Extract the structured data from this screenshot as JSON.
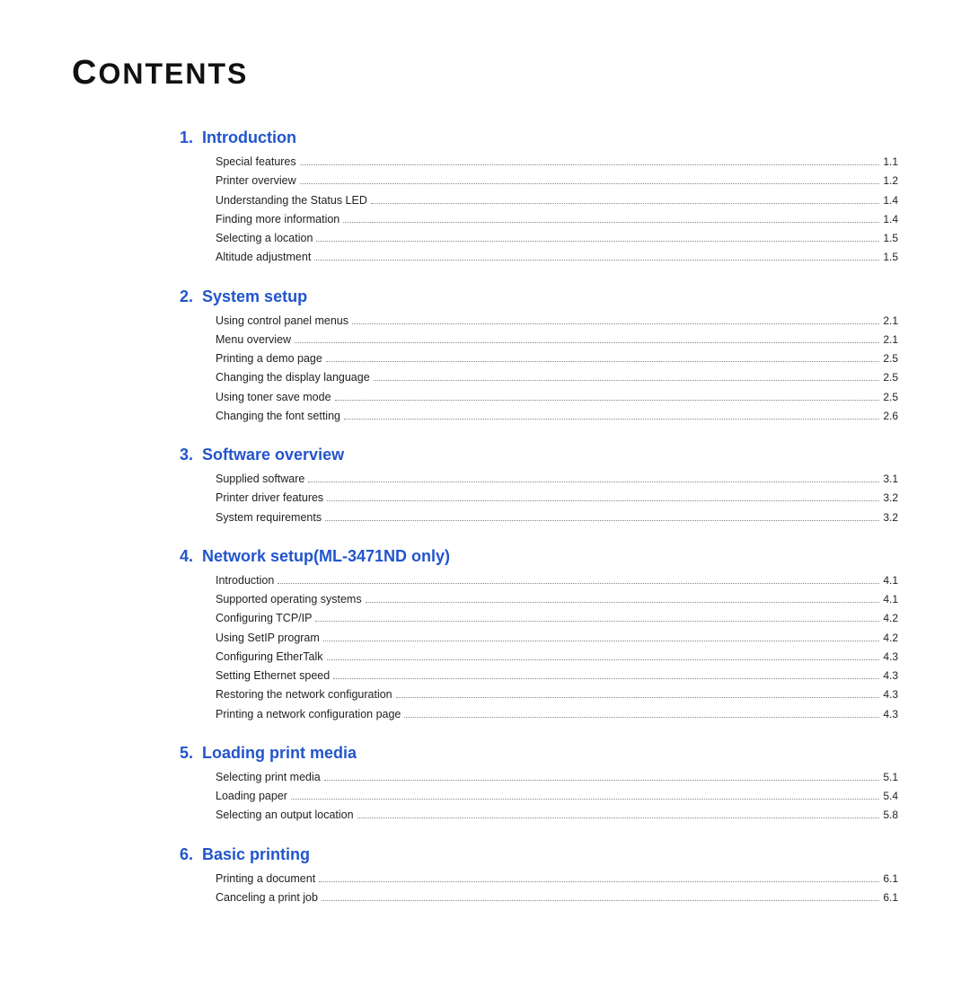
{
  "title": "Contents",
  "sections": [
    {
      "number": "1.",
      "heading": "Introduction",
      "entries": [
        {
          "label": "Special features",
          "page": "1.1"
        },
        {
          "label": "Printer overview",
          "page": "1.2"
        },
        {
          "label": "Understanding the Status LED",
          "page": "1.4"
        },
        {
          "label": "Finding more information",
          "page": "1.4"
        },
        {
          "label": "Selecting a location",
          "page": "1.5"
        },
        {
          "label": "Altitude adjustment",
          "page": "1.5"
        }
      ]
    },
    {
      "number": "2.",
      "heading": "System setup",
      "entries": [
        {
          "label": "Using control panel menus",
          "page": "2.1"
        },
        {
          "label": "Menu overview",
          "page": "2.1"
        },
        {
          "label": "Printing a demo page",
          "page": "2.5"
        },
        {
          "label": "Changing the display language",
          "page": "2.5"
        },
        {
          "label": "Using toner save mode",
          "page": "2.5"
        },
        {
          "label": "Changing the font setting",
          "page": "2.6"
        }
      ]
    },
    {
      "number": "3.",
      "heading": "Software overview",
      "entries": [
        {
          "label": "Supplied software",
          "page": "3.1"
        },
        {
          "label": "Printer driver features",
          "page": "3.2"
        },
        {
          "label": "System requirements",
          "page": "3.2"
        }
      ]
    },
    {
      "number": "4.",
      "heading": "Network setup(ML-3471ND only)",
      "entries": [
        {
          "label": "Introduction",
          "page": "4.1"
        },
        {
          "label": "Supported operating systems",
          "page": "4.1"
        },
        {
          "label": "Configuring TCP/IP",
          "page": "4.2"
        },
        {
          "label": "Using SetIP program",
          "page": "4.2"
        },
        {
          "label": "Configuring EtherTalk",
          "page": "4.3"
        },
        {
          "label": "Setting Ethernet speed",
          "page": "4.3"
        },
        {
          "label": "Restoring the network configuration",
          "page": "4.3"
        },
        {
          "label": "Printing a network configuration page",
          "page": "4.3"
        }
      ]
    },
    {
      "number": "5.",
      "heading": "Loading print media",
      "entries": [
        {
          "label": "Selecting print media",
          "page": "5.1"
        },
        {
          "label": "Loading paper",
          "page": "5.4"
        },
        {
          "label": "Selecting an output location",
          "page": "5.8"
        }
      ]
    },
    {
      "number": "6.",
      "heading": "Basic printing",
      "entries": [
        {
          "label": "Printing a document",
          "page": "6.1"
        },
        {
          "label": "Canceling a print job",
          "page": "6.1"
        }
      ]
    }
  ]
}
